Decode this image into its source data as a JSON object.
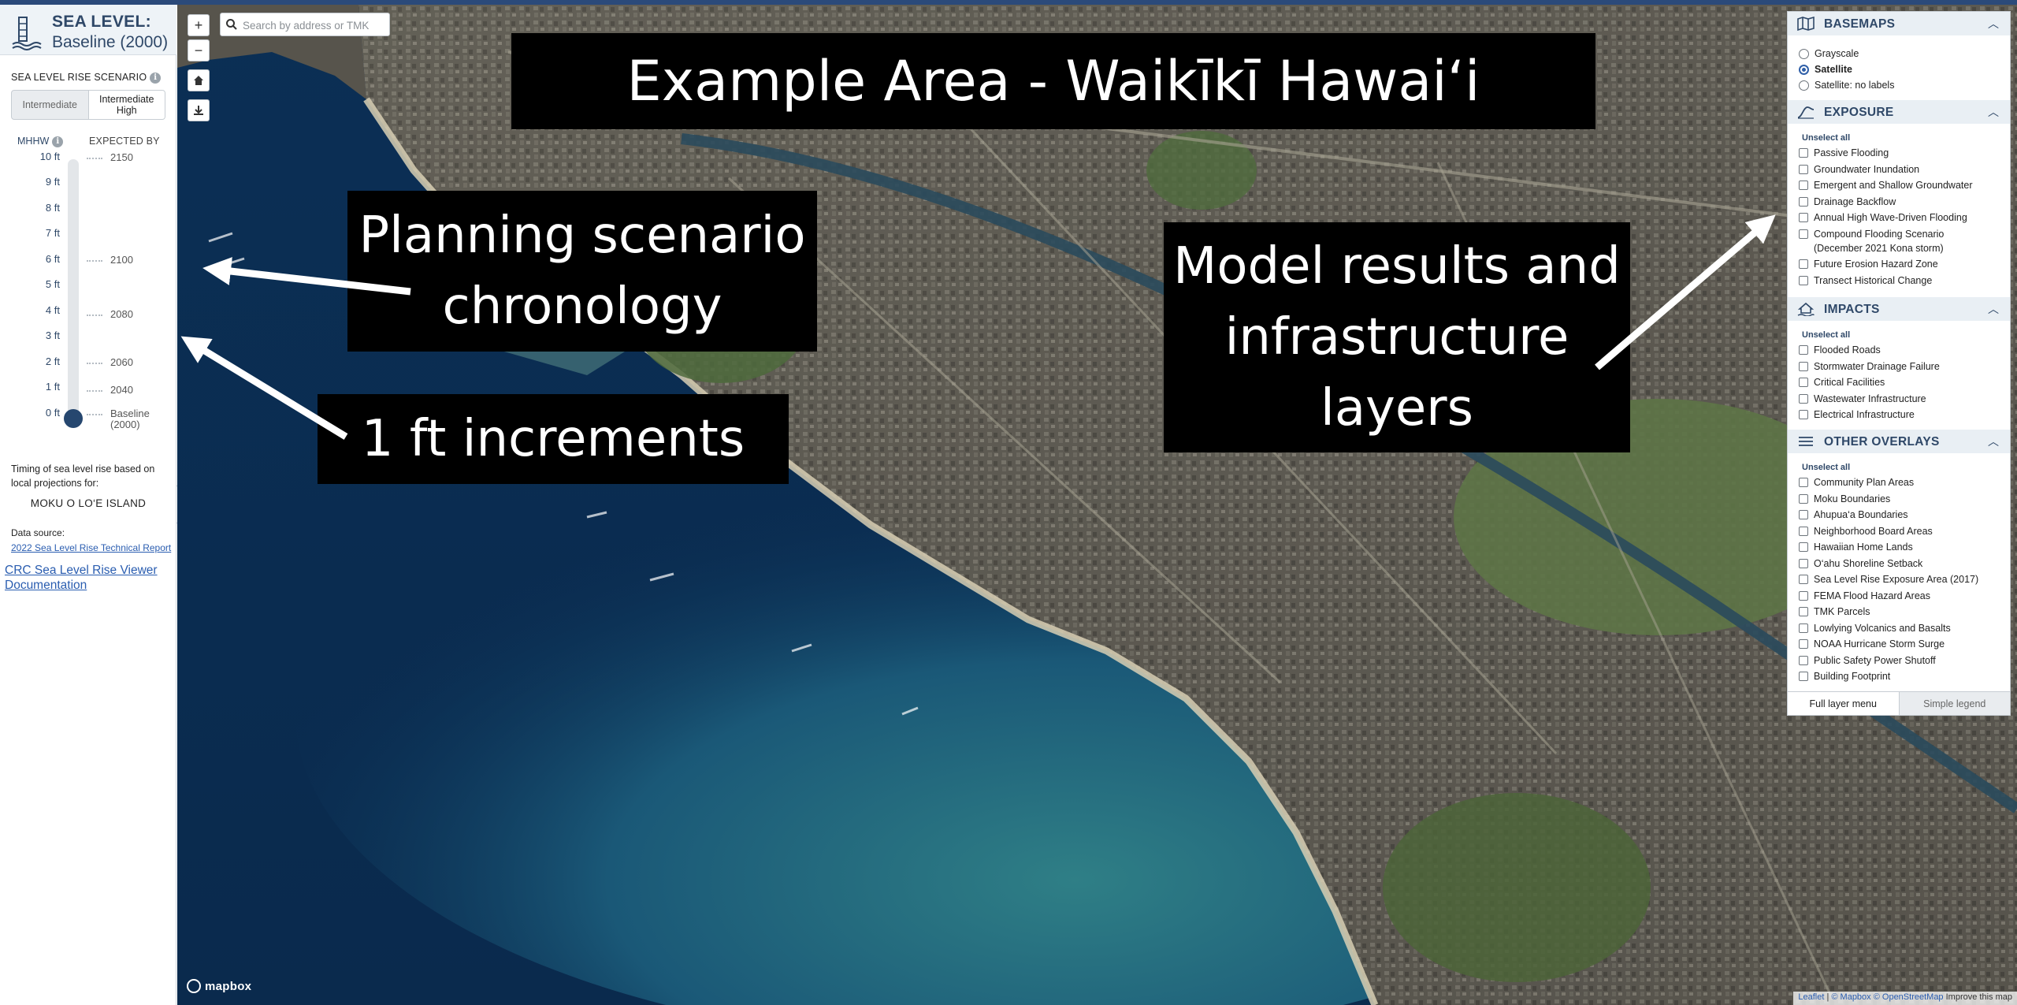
{
  "sidebar": {
    "title": "SEA LEVEL:",
    "subtitle": "Baseline (2000)",
    "scenario_label": "SEA LEVEL RISE SCENARIO",
    "scenario_options": [
      "Intermediate",
      "Intermediate High"
    ],
    "scenario_selected": "Intermediate High",
    "mhhw_label": "MHHW",
    "expected_label": "EXPECTED BY",
    "feet_labels": [
      "10 ft",
      "9 ft",
      "8 ft",
      "7 ft",
      "6 ft",
      "5 ft",
      "4 ft",
      "3 ft",
      "2 ft",
      "1 ft",
      "0 ft"
    ],
    "year_labels": {
      "ft10": "2150",
      "ft6": "2100",
      "ft4": "2080",
      "ft2": "2060",
      "ft1": "2040",
      "ft0": "Baseline (2000)"
    },
    "selected_level_ft": 0,
    "timing_text": "Timing of sea level rise based on local projections for:",
    "island_name": "MOKU O LO‘E ISLAND",
    "source_label": "Data source:",
    "source_link": "2022 Sea Level Rise Technical Report",
    "doc_link": "CRC Sea Level Rise Viewer Documentation"
  },
  "map": {
    "search_placeholder": "Search by address or TMK",
    "zoom_in": "+",
    "zoom_out": "−",
    "logo_text": "mapbox",
    "attribution": {
      "leaflet": "Leaflet",
      "mapbox": "© Mapbox",
      "osm": "© OpenStreetMap",
      "improve": "Improve this map"
    }
  },
  "annotations": {
    "title": "Example Area - Waikīkī Hawaiʻi",
    "planning_line1": "Planning scenario",
    "planning_line2": "chronology",
    "increments": "1 ft increments",
    "model_line1": "Model results and",
    "model_line2": "infrastructure",
    "model_line3": "layers"
  },
  "layers": {
    "basemaps": {
      "title": "BASEMAPS",
      "options": [
        "Grayscale",
        "Satellite",
        "Satellite: no labels"
      ],
      "selected": "Satellite"
    },
    "exposure": {
      "title": "EXPOSURE",
      "unselect": "Unselect all",
      "items": [
        "Passive Flooding",
        "Groundwater Inundation",
        "Emergent and Shallow Groundwater",
        "Drainage Backflow",
        "Annual High Wave-Driven Flooding",
        "Compound Flooding Scenario",
        "Future Erosion Hazard Zone",
        "Transect Historical Change"
      ],
      "compound_sub": "(December 2021 Kona storm)"
    },
    "impacts": {
      "title": "IMPACTS",
      "unselect": "Unselect all",
      "items": [
        "Flooded Roads",
        "Stormwater Drainage Failure",
        "Critical Facilities",
        "Wastewater Infrastructure",
        "Electrical Infrastructure"
      ]
    },
    "overlays": {
      "title": "OTHER OVERLAYS",
      "unselect": "Unselect all",
      "items": [
        "Community Plan Areas",
        "Moku Boundaries",
        "Ahupua‘a Boundaries",
        "Neighborhood Board Areas",
        "Hawaiian Home Lands",
        "O‘ahu Shoreline Setback",
        "Sea Level Rise Exposure Area (2017)",
        "FEMA Flood Hazard Areas",
        "TMK Parcels",
        "Lowlying Volcanics and Basalts",
        "NOAA Hurricane Storm Surge",
        "Public Safety Power Shutoff",
        "Building Footprint"
      ]
    },
    "tabs": [
      "Full layer menu",
      "Simple legend"
    ],
    "active_tab": "Full layer menu"
  },
  "colors": {
    "accent": "#2f4868",
    "link": "#2a5db0",
    "ocean": "#0b2f55",
    "land": "#5e5b52"
  }
}
